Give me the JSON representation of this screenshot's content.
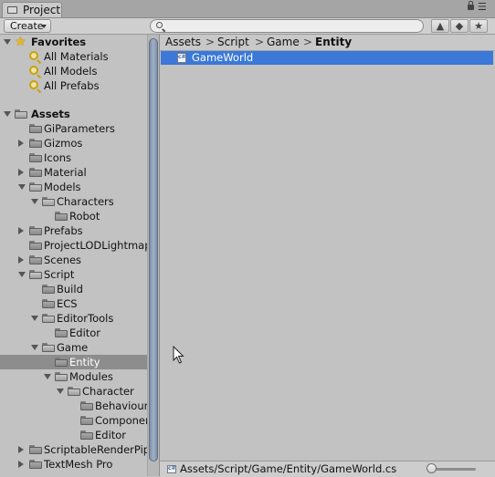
{
  "window": {
    "tab_title": "Project"
  },
  "toolbar": {
    "create_label": "Create",
    "search_value": ""
  },
  "favorites": {
    "title": "Favorites",
    "items": [
      {
        "label": "All Materials"
      },
      {
        "label": "All Models"
      },
      {
        "label": "All Prefabs"
      }
    ]
  },
  "assets": {
    "title": "Assets",
    "tree": [
      {
        "label": "GiParameters"
      },
      {
        "label": "Gizmos"
      },
      {
        "label": "Icons"
      },
      {
        "label": "Material"
      },
      {
        "label": "Models"
      },
      {
        "label": "Characters"
      },
      {
        "label": "Robot"
      },
      {
        "label": "Prefabs"
      },
      {
        "label": "ProjectLODLightmap"
      },
      {
        "label": "Scenes"
      },
      {
        "label": "Script"
      },
      {
        "label": "Build"
      },
      {
        "label": "ECS"
      },
      {
        "label": "EditorTools"
      },
      {
        "label": "Editor"
      },
      {
        "label": "Game"
      },
      {
        "label": "Entity"
      },
      {
        "label": "Modules"
      },
      {
        "label": "Character"
      },
      {
        "label": "Behaviour"
      },
      {
        "label": "Componer"
      },
      {
        "label": "Editor"
      },
      {
        "label": "ScriptableRenderPip"
      },
      {
        "label": "TextMesh Pro"
      }
    ]
  },
  "breadcrumb": [
    "Assets",
    "Script",
    "Game",
    "Entity"
  ],
  "breadcrumb_sep": ">",
  "content": {
    "files": [
      {
        "label": "GameWorld"
      }
    ]
  },
  "footer": {
    "path": "Assets/Script/Game/Entity/GameWorld.cs",
    "zoom": 0.0
  }
}
